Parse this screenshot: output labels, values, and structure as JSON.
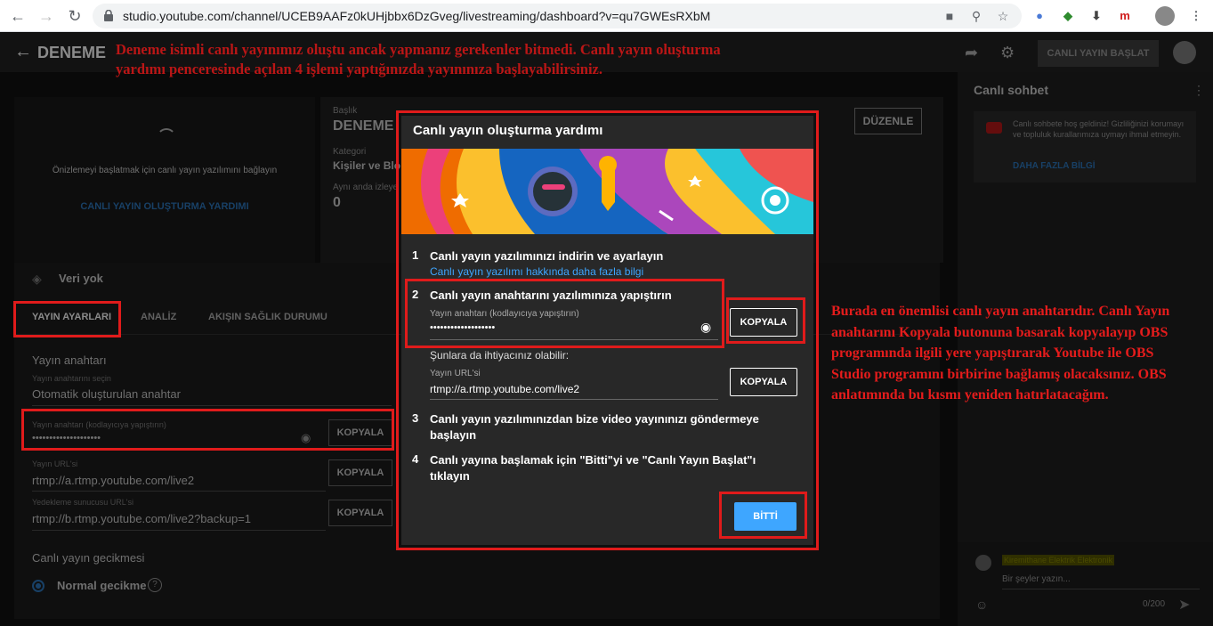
{
  "browser": {
    "url": "studio.youtube.com/channel/UCEB9AAFz0kUHjbbx6DzGveg/livestreaming/dashboard?v=qu7GWEsRXbM"
  },
  "studio": {
    "channel_title": "DENEME",
    "start_stream_label": "CANLI YAYIN BAŞLAT",
    "preview_message": "Önizlemeyi başlatmak için canlı yayın yazılımını bağlayın",
    "preview_link": "CANLI YAYIN OLUŞTURMA YARDIMI",
    "info": {
      "title_label": "Başlık",
      "title_value": "DENEME",
      "category_label": "Kategori",
      "category_value": "Kişiler ve Blo",
      "viewers_label": "Aynı anda izleye",
      "viewers_value": "0",
      "edit_label": "DÜZENLE"
    },
    "data_status": "Veri yok",
    "tabs": [
      "YAYIN AYARLARI",
      "ANALİZ",
      "AKIŞIN SAĞLIK DURUMU"
    ],
    "stream_key_section": "Yayın anahtarı",
    "key_select_label": "Yayın anahtarını seçin",
    "key_select_value": "Otomatik oluşturulan anahtar",
    "key_field_label": "Yayın anahtarı (kodlayıcıya yapıştırın)",
    "key_field_value": "••••••••••••••••••••",
    "url_label": "Yayın URL'si",
    "url_value": "rtmp://a.rtmp.youtube.com/live2",
    "backup_label": "Yedekleme sunucusu URL'si",
    "backup_value": "rtmp://b.rtmp.youtube.com/live2?backup=1",
    "copy_label": "KOPYALA",
    "latency_title": "Canlı yayın gecikmesi",
    "latency_option": "Normal gecikme"
  },
  "chat": {
    "title": "Canlı sohbet",
    "welcome": "Canlı sohbete hoş geldiniz! Gizliliğinizi korumayı ve topluluk kurallarımıza uymayı ihmal etmeyin.",
    "more": "DAHA FAZLA BİLGİ",
    "user": "Kiremithane Elektrik Elektronik",
    "input_placeholder": "Bir şeyler yazın...",
    "counter": "0/200"
  },
  "dialog": {
    "title": "Canlı yayın oluşturma yardımı",
    "step1": "Canlı yayın yazılımınızı indirin ve ayarlayın",
    "step1_link": "Canlı yayın yazılımı hakkında daha fazla bilgi",
    "step2": "Canlı yayın anahtarını yazılımınıza yapıştırın",
    "key_label": "Yayın anahtarı (kodlayıcıya yapıştırın)",
    "key_value": "•••••••••••••••••••",
    "copy_label": "KOPYALA",
    "also_need": "Şunlara da ihtiyacınız olabilir:",
    "url_label": "Yayın URL'si",
    "url_value": "rtmp://a.rtmp.youtube.com/live2",
    "step3": "Canlı yayın yazılımınızdan bize video yayınınızı göndermeye başlayın",
    "step4": "Canlı yayına başlamak için \"Bitti\"yi ve \"Canlı Yayın Başlat\"ı tıklayın",
    "done_label": "BİTTİ",
    "nums": [
      "1",
      "2",
      "3",
      "4"
    ]
  },
  "annotations": {
    "top": "Deneme isimli canlı yayınımız oluştu ancak yapmanız gerekenler bitmedi. Canlı yayın oluşturma yardımı penceresinde açılan 4 işlemi yaptığınızda yayınınıza başlayabilirsiniz.",
    "right": "Burada en önemlisi canlı yayın anahtarıdır. Canlı Yayın anahtarını Kopyala butonuna basarak kopyalayıp OBS programında ilgili yere yapıştırarak Youtube ile OBS Studio programını birbirine bağlamış olacaksınız. OBS anlatımında bu kısmı yeniden hatırlatacağım."
  },
  "colors": {
    "accent_blue": "#3ea6ff",
    "annotation_red": "#e01b1b"
  }
}
